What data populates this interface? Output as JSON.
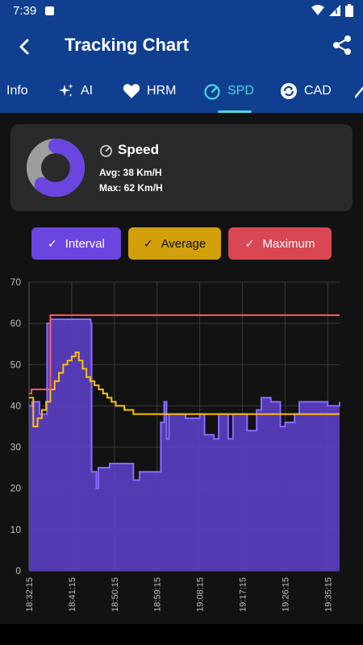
{
  "status": {
    "time": "7:39"
  },
  "appbar": {
    "title": "Tracking Chart"
  },
  "tabs": [
    {
      "label": "Info",
      "icon": "info"
    },
    {
      "label": "AI",
      "icon": "sparkles-icon"
    },
    {
      "label": "HRM",
      "icon": "heart-icon"
    },
    {
      "label": "SPD",
      "icon": "speedometer-icon",
      "active": true
    },
    {
      "label": "CAD",
      "icon": "cadence-icon"
    }
  ],
  "summary": {
    "label": "Speed",
    "avg": "Avg: 38 Km/H",
    "max": "Max: 62 Km/H",
    "gauge_fraction": 0.61
  },
  "legend": {
    "interval": "Interval",
    "average": "Average",
    "maximum": "Maximum"
  },
  "colors": {
    "interval": "#6b45e0",
    "interval_fill": "#5b3fc4",
    "average": "#ffc107",
    "maximum": "#ff5a5f",
    "tab_active": "#4dd8e0",
    "header": "#103f8f"
  },
  "chart_data": {
    "type": "line",
    "ylim": [
      0,
      70
    ],
    "yticks": [
      0,
      10,
      20,
      30,
      40,
      50,
      60,
      70
    ],
    "xlim": [
      "18:32:15",
      "18:36:15"
    ],
    "xtick_labels": [
      "18:32:15",
      "18:41:15",
      "18:50:15",
      "18:59:15",
      "19:08:15",
      "19:17:15",
      "19:26:15",
      "19:35:15"
    ],
    "xtick_minutes": [
      0,
      9,
      18,
      27,
      36,
      45,
      54,
      63
    ],
    "x_end_minutes": 65.5,
    "series": [
      {
        "name": "Interval",
        "kind": "step-area",
        "points": [
          [
            0,
            40
          ],
          [
            0.6,
            41
          ],
          [
            2.2,
            38
          ],
          [
            3.8,
            60
          ],
          [
            4.5,
            61
          ],
          [
            8.1,
            61
          ],
          [
            13.0,
            60
          ],
          [
            13.2,
            24
          ],
          [
            14.2,
            20
          ],
          [
            14.6,
            25
          ],
          [
            17.0,
            26
          ],
          [
            21.0,
            26
          ],
          [
            22.0,
            22
          ],
          [
            23.3,
            24
          ],
          [
            27.5,
            24
          ],
          [
            27.8,
            36
          ],
          [
            28.5,
            41
          ],
          [
            29.0,
            32
          ],
          [
            29.5,
            38
          ],
          [
            33.0,
            37
          ],
          [
            36.0,
            38
          ],
          [
            37.0,
            33
          ],
          [
            39.0,
            32
          ],
          [
            40.0,
            38
          ],
          [
            42.0,
            32
          ],
          [
            43.0,
            38
          ],
          [
            45.0,
            38
          ],
          [
            46.0,
            34
          ],
          [
            48.0,
            39
          ],
          [
            49.0,
            42
          ],
          [
            51.0,
            41
          ],
          [
            53.0,
            35
          ],
          [
            54.0,
            36
          ],
          [
            55.0,
            36
          ],
          [
            56.0,
            38
          ],
          [
            57.0,
            41
          ],
          [
            61.0,
            41
          ],
          [
            63.0,
            40
          ],
          [
            65.5,
            41
          ]
        ]
      },
      {
        "name": "Average",
        "kind": "step-line",
        "points": [
          [
            0,
            42
          ],
          [
            0.9,
            35
          ],
          [
            1.8,
            37
          ],
          [
            2.7,
            39
          ],
          [
            3.6,
            41
          ],
          [
            4.5,
            44
          ],
          [
            5.4,
            46
          ],
          [
            6.3,
            48
          ],
          [
            7.2,
            50
          ],
          [
            8.1,
            51
          ],
          [
            9.0,
            52
          ],
          [
            9.8,
            53
          ],
          [
            10.5,
            51
          ],
          [
            11.3,
            49
          ],
          [
            12.1,
            47
          ],
          [
            12.9,
            46
          ],
          [
            13.8,
            45
          ],
          [
            14.7,
            44
          ],
          [
            15.6,
            43
          ],
          [
            16.5,
            42
          ],
          [
            17.4,
            41
          ],
          [
            18.3,
            40
          ],
          [
            19.2,
            40
          ],
          [
            20.1,
            39
          ],
          [
            21.0,
            39
          ],
          [
            22.0,
            38
          ],
          [
            23.0,
            38
          ],
          [
            24.5,
            38
          ],
          [
            26.0,
            38
          ],
          [
            65.5,
            38
          ]
        ]
      },
      {
        "name": "Maximum",
        "kind": "step-line",
        "points": [
          [
            0,
            43
          ],
          [
            0.5,
            44
          ],
          [
            4.5,
            62
          ],
          [
            65.5,
            62
          ]
        ]
      }
    ]
  }
}
